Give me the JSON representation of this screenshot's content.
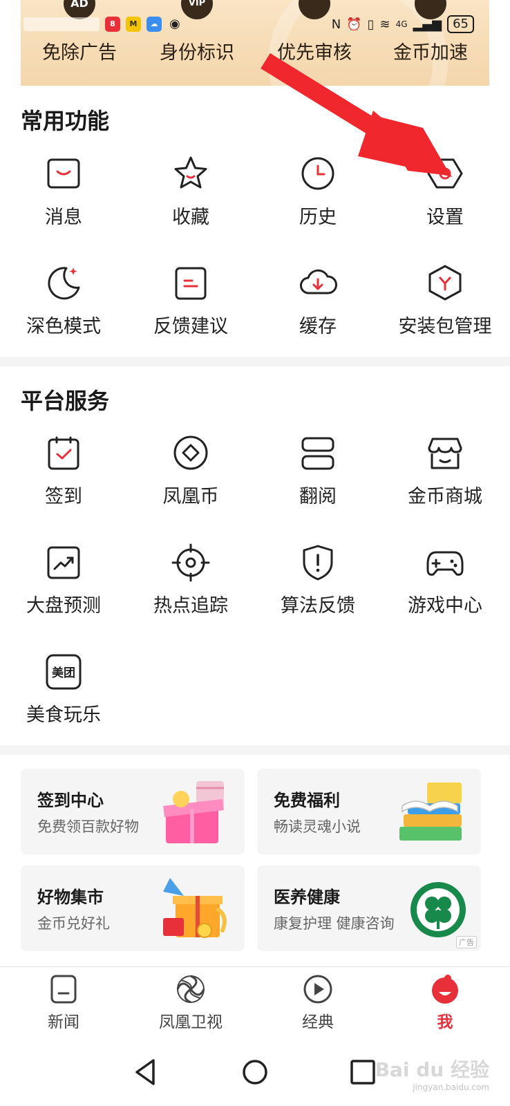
{
  "status_bar": {
    "battery": "65",
    "network": "4G"
  },
  "privileges": [
    {
      "label": "免除广告",
      "icon_text": "AD"
    },
    {
      "label": "身份标识",
      "icon_text": "VIP"
    },
    {
      "label": "优先审核",
      "icon_text": ""
    },
    {
      "label": "金币加速",
      "icon_text": ""
    }
  ],
  "common_functions": {
    "title": "常用功能",
    "items": [
      {
        "label": "消息",
        "icon": "message-icon"
      },
      {
        "label": "收藏",
        "icon": "star-icon"
      },
      {
        "label": "历史",
        "icon": "clock-icon"
      },
      {
        "label": "设置",
        "icon": "gear-icon"
      },
      {
        "label": "深色模式",
        "icon": "moon-icon"
      },
      {
        "label": "反馈建议",
        "icon": "feedback-icon"
      },
      {
        "label": "缓存",
        "icon": "cloud-download-icon"
      },
      {
        "label": "安装包管理",
        "icon": "package-icon"
      }
    ]
  },
  "platform_services": {
    "title": "平台服务",
    "items": [
      {
        "label": "签到",
        "icon": "checkin-icon"
      },
      {
        "label": "凤凰币",
        "icon": "coin-icon"
      },
      {
        "label": "翻阅",
        "icon": "browse-icon"
      },
      {
        "label": "金币商城",
        "icon": "shop-icon"
      },
      {
        "label": "大盘预测",
        "icon": "trend-icon"
      },
      {
        "label": "热点追踪",
        "icon": "target-icon"
      },
      {
        "label": "算法反馈",
        "icon": "shield-alert-icon"
      },
      {
        "label": "游戏中心",
        "icon": "gamepad-icon"
      },
      {
        "label": "美食玩乐",
        "icon": "meituan-icon",
        "icon_text": "美团"
      }
    ]
  },
  "cards": [
    {
      "title": "签到中心",
      "subtitle": "免费领百款好物"
    },
    {
      "title": "免费福利",
      "subtitle": "畅读灵魂小说"
    },
    {
      "title": "好物集市",
      "subtitle": "金币兑好礼"
    },
    {
      "title": "医养健康",
      "subtitle": "康复护理 健康咨询",
      "ad_label": "广告"
    }
  ],
  "bottom_nav": [
    {
      "label": "新闻",
      "icon": "news-icon",
      "active": false
    },
    {
      "label": "凤凰卫视",
      "icon": "phoenix-icon",
      "active": false
    },
    {
      "label": "经典",
      "icon": "play-icon",
      "active": false
    },
    {
      "label": "我",
      "icon": "me-avatar-icon",
      "active": true
    }
  ],
  "watermark": {
    "text": "Bai du 经验",
    "sub": "jingyan.baidu.com"
  },
  "colors": {
    "accent": "#e8303a",
    "banner": "#f6dcb4",
    "arrow": "#f0282d"
  }
}
